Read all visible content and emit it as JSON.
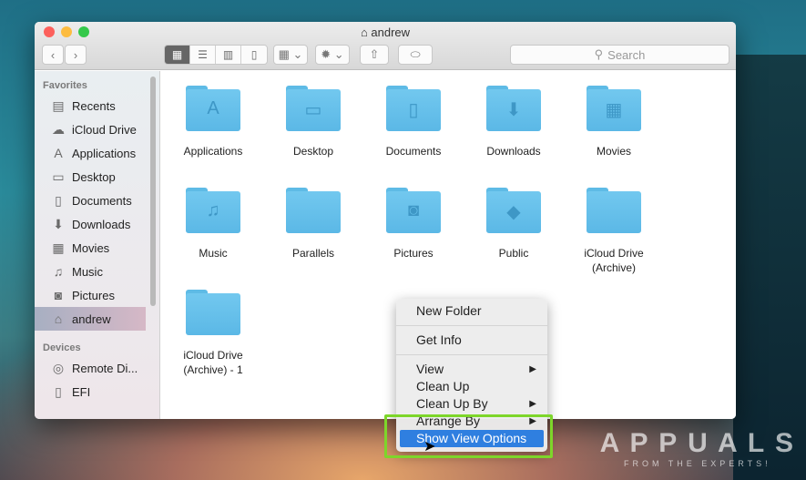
{
  "window": {
    "title": "andrew"
  },
  "toolbar": {
    "back": "‹",
    "forward": "›",
    "view_modes": [
      "icon",
      "list",
      "column",
      "cover-flow"
    ],
    "search_placeholder": "Search"
  },
  "sidebar": {
    "favorites_header": "Favorites",
    "favorites": [
      {
        "label": "Recents",
        "icon": "▤"
      },
      {
        "label": "iCloud Drive",
        "icon": "☁"
      },
      {
        "label": "Applications",
        "icon": "A"
      },
      {
        "label": "Desktop",
        "icon": "▭"
      },
      {
        "label": "Documents",
        "icon": "▯"
      },
      {
        "label": "Downloads",
        "icon": "⬇"
      },
      {
        "label": "Movies",
        "icon": "▦"
      },
      {
        "label": "Music",
        "icon": "♫"
      },
      {
        "label": "Pictures",
        "icon": "◙"
      },
      {
        "label": "andrew",
        "icon": "⌂"
      }
    ],
    "devices_header": "Devices",
    "devices": [
      {
        "label": "Remote Di...",
        "icon": "◎"
      },
      {
        "label": "EFI",
        "icon": "▯"
      }
    ]
  },
  "folders": [
    {
      "label": "Applications",
      "glyph": "A"
    },
    {
      "label": "Desktop",
      "glyph": "▭"
    },
    {
      "label": "Documents",
      "glyph": "▯"
    },
    {
      "label": "Downloads",
      "glyph": "⬇"
    },
    {
      "label": "Movies",
      "glyph": "▦"
    },
    {
      "label": "Music",
      "glyph": "♫"
    },
    {
      "label": "Parallels",
      "glyph": ""
    },
    {
      "label": "Pictures",
      "glyph": "◙"
    },
    {
      "label": "Public",
      "glyph": "◆"
    },
    {
      "label": "iCloud Drive (Archive)",
      "glyph": ""
    },
    {
      "label": "iCloud Drive (Archive) - 1",
      "glyph": ""
    }
  ],
  "context_menu": {
    "items": [
      "New Folder",
      "Get Info",
      "View",
      "Clean Up",
      "Clean Up By",
      "Arrange By",
      "Show View Options"
    ],
    "submenu_arrow": "▶"
  },
  "watermark": {
    "title": "APPUALS",
    "subtitle": "FROM THE EXPERTS!"
  }
}
